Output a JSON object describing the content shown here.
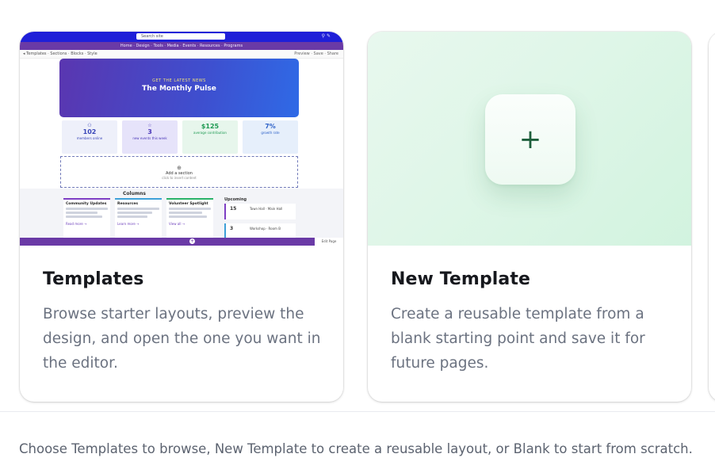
{
  "cards": [
    {
      "title": "Templates",
      "description": "Browse starter layouts, preview the design, and open the one you want in the editor.",
      "preview": {
        "search_text": "Search site",
        "nav_items": "Home · Design · Tools · Media · Events · Resources · Programs",
        "toolbar_left": "◂ Templates · Sections · Blocks · Style",
        "toolbar_right": "Preview · Save · Share",
        "hero_kicker": "GET THE LATEST NEWS",
        "hero_title": "The Monthly Pulse",
        "stats": [
          {
            "icon": "⚇",
            "value": "102",
            "label": "members online",
            "color": "#3946b8",
            "bg": "#eef0fa"
          },
          {
            "icon": "☆",
            "value": "3",
            "label": "new events this week",
            "color": "#4a36b8",
            "bg": "#e6e3fa"
          },
          {
            "icon": "",
            "value": "$125",
            "label": "average contribution",
            "color": "#1e9a52",
            "bg": "#e7f6ec"
          },
          {
            "icon": "",
            "value": "7%",
            "label": "growth rate",
            "color": "#2f62c8",
            "bg": "#e6effb"
          }
        ],
        "dashed_title": "Add a section",
        "dashed_sub": "click to insert content",
        "section_title": "Columns",
        "columns": [
          {
            "heading": "Community Updates",
            "link": "Read more →",
            "color": "#7e3fc4"
          },
          {
            "heading": "Resources",
            "link": "Learn more →",
            "color": "#3ea0d8"
          },
          {
            "heading": "Volunteer Spotlight",
            "link": "View all →",
            "color": "#2bb26a"
          }
        ],
        "upcoming_title": "Upcoming",
        "events": [
          {
            "day": "15",
            "text": "Town Hall · Main Hall"
          },
          {
            "day": "3",
            "text": "Workshop · Room B"
          }
        ],
        "bottom_right": "Edit Page"
      }
    },
    {
      "title": "New Template",
      "description": "Create a reusable template from a blank starting point and save it for future pages.",
      "plus_symbol": "+"
    }
  ],
  "footer": {
    "hint": "Choose Templates to browse, New Template to create a reusable layout, or Blank to start from scratch."
  },
  "colors": {
    "card_title": "#16181d",
    "card_desc": "#6b7280",
    "preview_nav": "#6a3aa6",
    "preview_topbar": "#1f1fd8",
    "new_template_bg": "#dff6e8",
    "plus_color": "#1e5f3c"
  }
}
